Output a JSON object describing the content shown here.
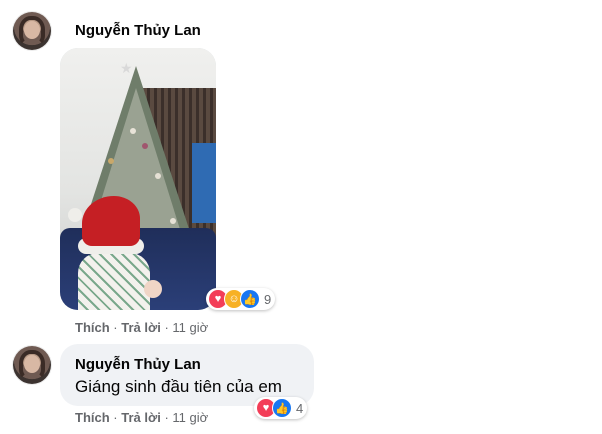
{
  "comments": [
    {
      "author": "Nguyễn Thủy Lan",
      "actions": {
        "like": "Thích",
        "reply": "Trả lời",
        "time": "11 giờ"
      },
      "reaction_count": "9",
      "reactions": [
        "heart-icon",
        "care-icon",
        "like-icon"
      ]
    },
    {
      "author": "Nguyễn Thủy Lan",
      "text": "Giáng sinh đầu tiên của em",
      "actions": {
        "like": "Thích",
        "reply": "Trả lời",
        "time": "11 giờ"
      },
      "reaction_count": "4",
      "reactions": [
        "heart-icon",
        "like-icon"
      ]
    }
  ],
  "colors": {
    "bubble": "#f0f2f5",
    "meta_text": "#65676b",
    "like_blue": "#1877f2",
    "heart_red": "#f33e58",
    "care_yellow": "#f7b125"
  }
}
